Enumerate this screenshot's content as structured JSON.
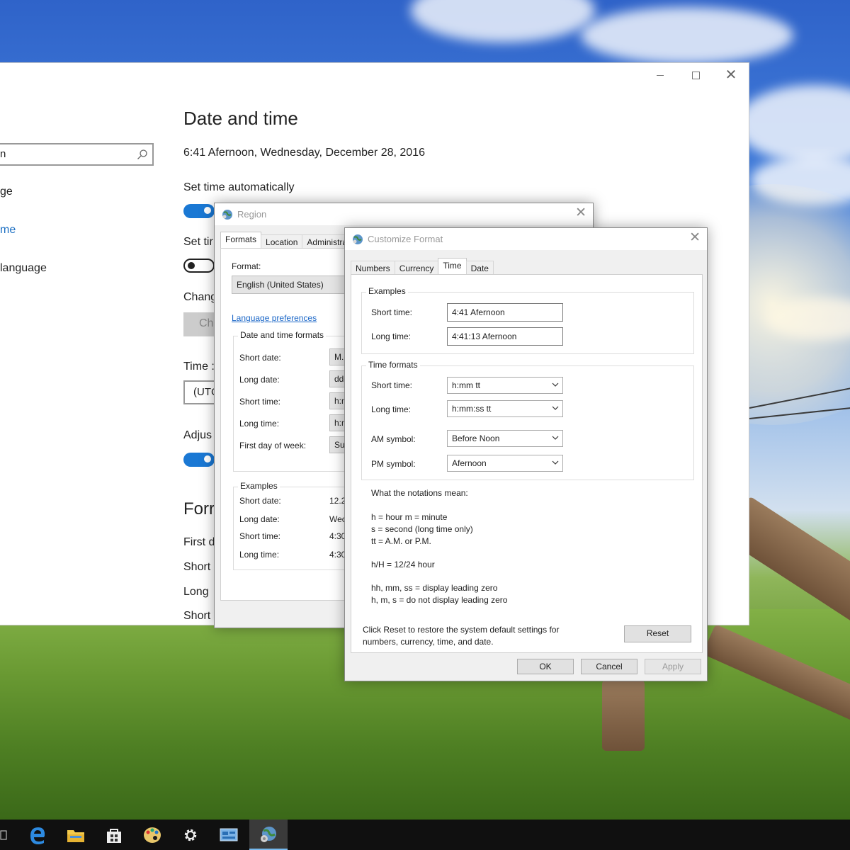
{
  "settings": {
    "title": "Date and time",
    "current_time": "6:41 Afernoon, Wednesday, December 28, 2016",
    "set_time_auto_label": "Set time automatically",
    "set_timezone_partial": "Set tir",
    "change_partial": "Chang",
    "change_button_partial": "Ch",
    "timezone_partial": "Time :",
    "timezone_value_partial": "(UTC",
    "adjust_partial": "Adjus",
    "formats_heading_partial": "Forr",
    "first_day_partial": "First d",
    "short_partial_1": "Short",
    "long_partial": "Long",
    "short_partial_2": "Short",
    "search_text": "n",
    "nav": [
      {
        "label": "ge"
      },
      {
        "label": "me"
      },
      {
        "label": "language"
      }
    ]
  },
  "region": {
    "title": "Region",
    "tabs": [
      "Formats",
      "Location",
      "Administrat"
    ],
    "format_label": "Format:",
    "format_value": "English (United States)",
    "language_link": "Language preferences",
    "date_time_group": "Date and time formats",
    "rows": [
      {
        "label": "Short date:",
        "value": "M.c"
      },
      {
        "label": "Long date:",
        "value": "ddc"
      },
      {
        "label": "Short time:",
        "value": "h:n"
      },
      {
        "label": "Long time:",
        "value": "h:n"
      },
      {
        "label": "First day of week:",
        "value": "Sur"
      }
    ],
    "examples_group": "Examples",
    "examples": [
      {
        "label": "Short date:",
        "value": "12.2"
      },
      {
        "label": "Long date:",
        "value": "Wec"
      },
      {
        "label": "Short time:",
        "value": "4:30"
      },
      {
        "label": "Long time:",
        "value": "4:30"
      }
    ]
  },
  "customize": {
    "title": "Customize Format",
    "tabs": [
      "Numbers",
      "Currency",
      "Time",
      "Date"
    ],
    "active_tab": "Time",
    "examples_group": "Examples",
    "short_time_label": "Short time:",
    "short_time_value": "4:41 Afernoon",
    "long_time_label": "Long time:",
    "long_time_value": "4:41:13 Afernoon",
    "time_formats_group": "Time formats",
    "fmt_short_label": "Short time:",
    "fmt_short_value": "h:mm tt",
    "fmt_long_label": "Long time:",
    "fmt_long_value": "h:mm:ss tt",
    "am_label": "AM symbol:",
    "am_value": "Before Noon",
    "pm_label": "PM symbol:",
    "pm_value": "Afernoon",
    "notation_title": "What the notations mean:",
    "notations": [
      "h = hour   m = minute",
      "s = second (long time only)",
      "tt = A.M. or P.M.",
      "h/H = 12/24 hour",
      "hh, mm, ss = display leading zero",
      "h, m, s = do not display leading zero"
    ],
    "reset_note_1": "Click Reset to restore the system default settings for",
    "reset_note_2": "numbers, currency, time, and date.",
    "reset_label": "Reset",
    "ok_label": "OK",
    "cancel_label": "Cancel",
    "apply_label": "Apply"
  },
  "taskbar": {
    "items": [
      "task-view-icon",
      "edge-icon",
      "file-explorer-icon",
      "store-icon",
      "paint-icon",
      "settings-icon",
      "control-panel-icon",
      "region-icon"
    ],
    "active_item": "region-icon"
  },
  "colors": {
    "accent": "#1a78d4",
    "link": "#1a66c7",
    "taskbar": "#101010"
  }
}
